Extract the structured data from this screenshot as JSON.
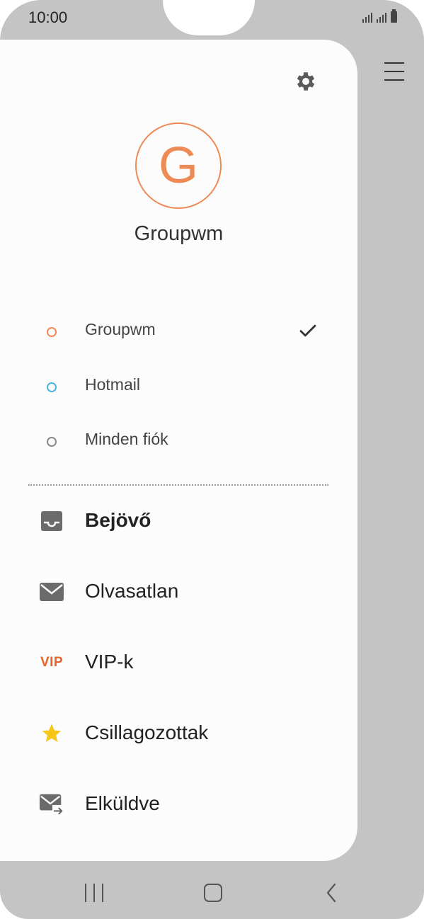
{
  "status_bar": {
    "time": "10:00"
  },
  "drawer": {
    "profile_initial": "G",
    "profile_name": "Groupwm",
    "accounts": [
      {
        "label": "Groupwm",
        "dot_color": "#ee8a55",
        "selected": true
      },
      {
        "label": "Hotmail",
        "dot_color": "#4fb3e0",
        "selected": false
      },
      {
        "label": "Minden fiók",
        "dot_color": "#8a8a8a",
        "selected": false
      }
    ],
    "folders": [
      {
        "label": "Bejövő",
        "icon": "inbox-icon",
        "bold": true
      },
      {
        "label": "Olvasatlan",
        "icon": "envelope-icon",
        "bold": false
      },
      {
        "label": "VIP-k",
        "icon": "vip-icon",
        "icon_text": "VIP",
        "bold": false
      },
      {
        "label": "Csillagozottak",
        "icon": "star-icon",
        "bold": false
      },
      {
        "label": "Elküldve",
        "icon": "sent-mail-icon",
        "bold": false
      }
    ]
  },
  "colors": {
    "accent": "#ee8a55",
    "vip": "#e8632b",
    "star": "#f5c518"
  }
}
